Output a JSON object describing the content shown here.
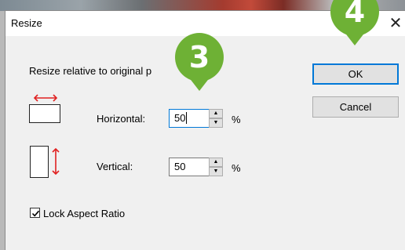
{
  "dialog": {
    "title": "Resize",
    "close_glyph": "✕",
    "heading": "Resize relative to original p",
    "horizontal": {
      "label": "Horizontal:",
      "value": "50",
      "unit": "%"
    },
    "vertical": {
      "label": "Vertical:",
      "value": "50",
      "unit": "%"
    },
    "lock": {
      "label": "Lock Aspect Ratio",
      "checked": true
    },
    "ok_label": "OK",
    "cancel_label": "Cancel"
  },
  "badges": {
    "step3": "3",
    "step4": "4"
  },
  "colors": {
    "accent": "#0078d7",
    "badge": "#6eb135",
    "arrow": "#e02020"
  },
  "icons": [
    "horizontal-resize-icon",
    "vertical-resize-icon",
    "checkmark-icon",
    "spin-up-icon",
    "spin-down-icon"
  ]
}
